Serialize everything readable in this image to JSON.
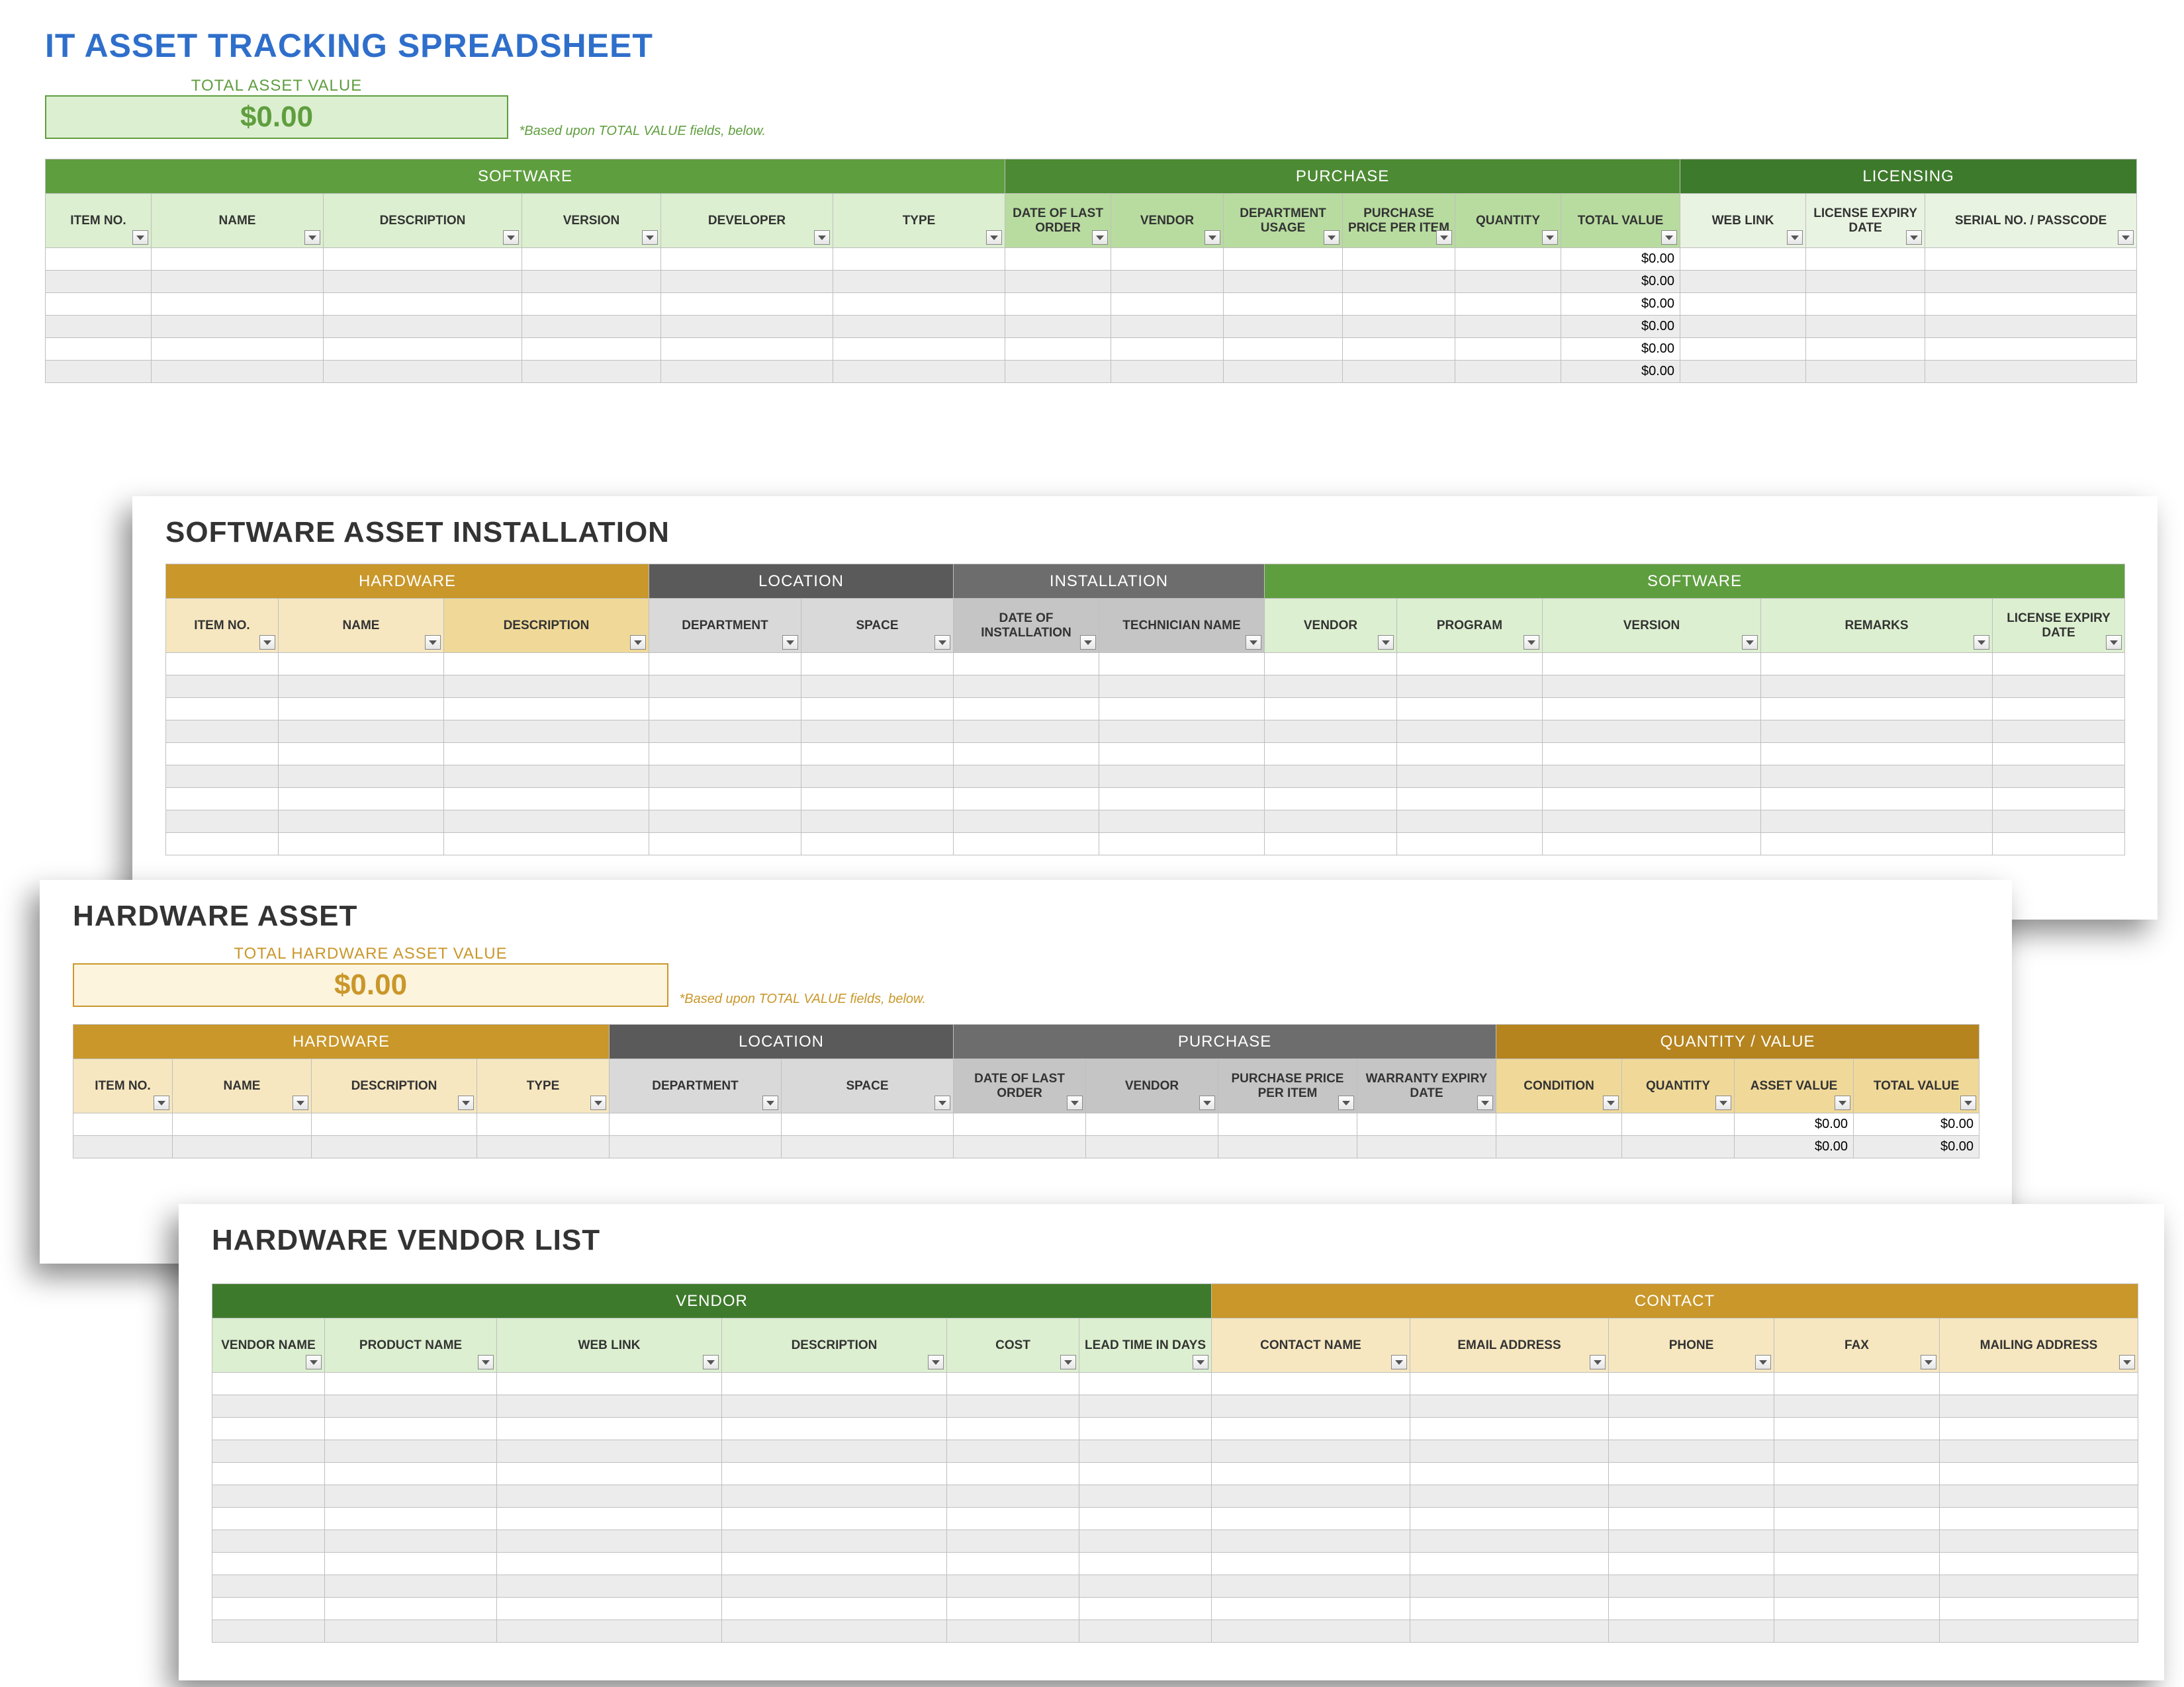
{
  "sheet1": {
    "title": "IT ASSET TRACKING SPREADSHEET",
    "total_label": "TOTAL ASSET VALUE",
    "total_value": "$0.00",
    "footnote": "*Based upon TOTAL VALUE fields, below.",
    "bands": {
      "b1": "SOFTWARE",
      "b2": "PURCHASE",
      "b3": "LICENSING"
    },
    "cols": {
      "c1": "ITEM NO.",
      "c2": "NAME",
      "c3": "DESCRIPTION",
      "c4": "VERSION",
      "c5": "DEVELOPER",
      "c6": "TYPE",
      "c7": "DATE OF LAST ORDER",
      "c8": "VENDOR",
      "c9": "DEPARTMENT USAGE",
      "c10": "PURCHASE PRICE PER ITEM",
      "c11": "QUANTITY",
      "c12": "TOTAL VALUE",
      "c13": "WEB LINK",
      "c14": "LICENSE EXPIRY DATE",
      "c15": "SERIAL NO. / PASSCODE"
    },
    "total_cell": "$0.00"
  },
  "sheet2": {
    "title": "SOFTWARE ASSET INSTALLATION",
    "bands": {
      "b1": "HARDWARE",
      "b2": "LOCATION",
      "b3": "INSTALLATION",
      "b4": "SOFTWARE"
    },
    "cols": {
      "c1": "ITEM NO.",
      "c2": "NAME",
      "c3": "DESCRIPTION",
      "c4": "DEPARTMENT",
      "c5": "SPACE",
      "c6": "DATE OF INSTALLATION",
      "c7": "TECHNICIAN NAME",
      "c8": "VENDOR",
      "c9": "PROGRAM",
      "c10": "VERSION",
      "c11": "REMARKS",
      "c12": "LICENSE EXPIRY DATE"
    }
  },
  "sheet3": {
    "title": "HARDWARE ASSET",
    "total_label": "TOTAL HARDWARE ASSET VALUE",
    "total_value": "$0.00",
    "footnote": "*Based upon TOTAL VALUE fields, below.",
    "bands": {
      "b1": "HARDWARE",
      "b2": "LOCATION",
      "b3": "PURCHASE",
      "b4": "QUANTITY / VALUE"
    },
    "cols": {
      "c1": "ITEM NO.",
      "c2": "NAME",
      "c3": "DESCRIPTION",
      "c4": "TYPE",
      "c5": "DEPARTMENT",
      "c6": "SPACE",
      "c7": "DATE OF LAST ORDER",
      "c8": "VENDOR",
      "c9": "PURCHASE PRICE PER ITEM",
      "c10": "WARRANTY EXPIRY DATE",
      "c11": "CONDITION",
      "c12": "QUANTITY",
      "c13": "ASSET VALUE",
      "c14": "TOTAL VALUE"
    },
    "val_cell": "$0.00"
  },
  "sheet4": {
    "title": "HARDWARE VENDOR LIST",
    "bands": {
      "b1": "VENDOR",
      "b2": "CONTACT"
    },
    "cols": {
      "c1": "VENDOR NAME",
      "c2": "PRODUCT NAME",
      "c3": "WEB LINK",
      "c4": "DESCRIPTION",
      "c5": "COST",
      "c6": "LEAD TIME IN DAYS",
      "c7": "CONTACT NAME",
      "c8": "EMAIL ADDRESS",
      "c9": "PHONE",
      "c10": "FAX",
      "c11": "MAILING ADDRESS"
    }
  }
}
